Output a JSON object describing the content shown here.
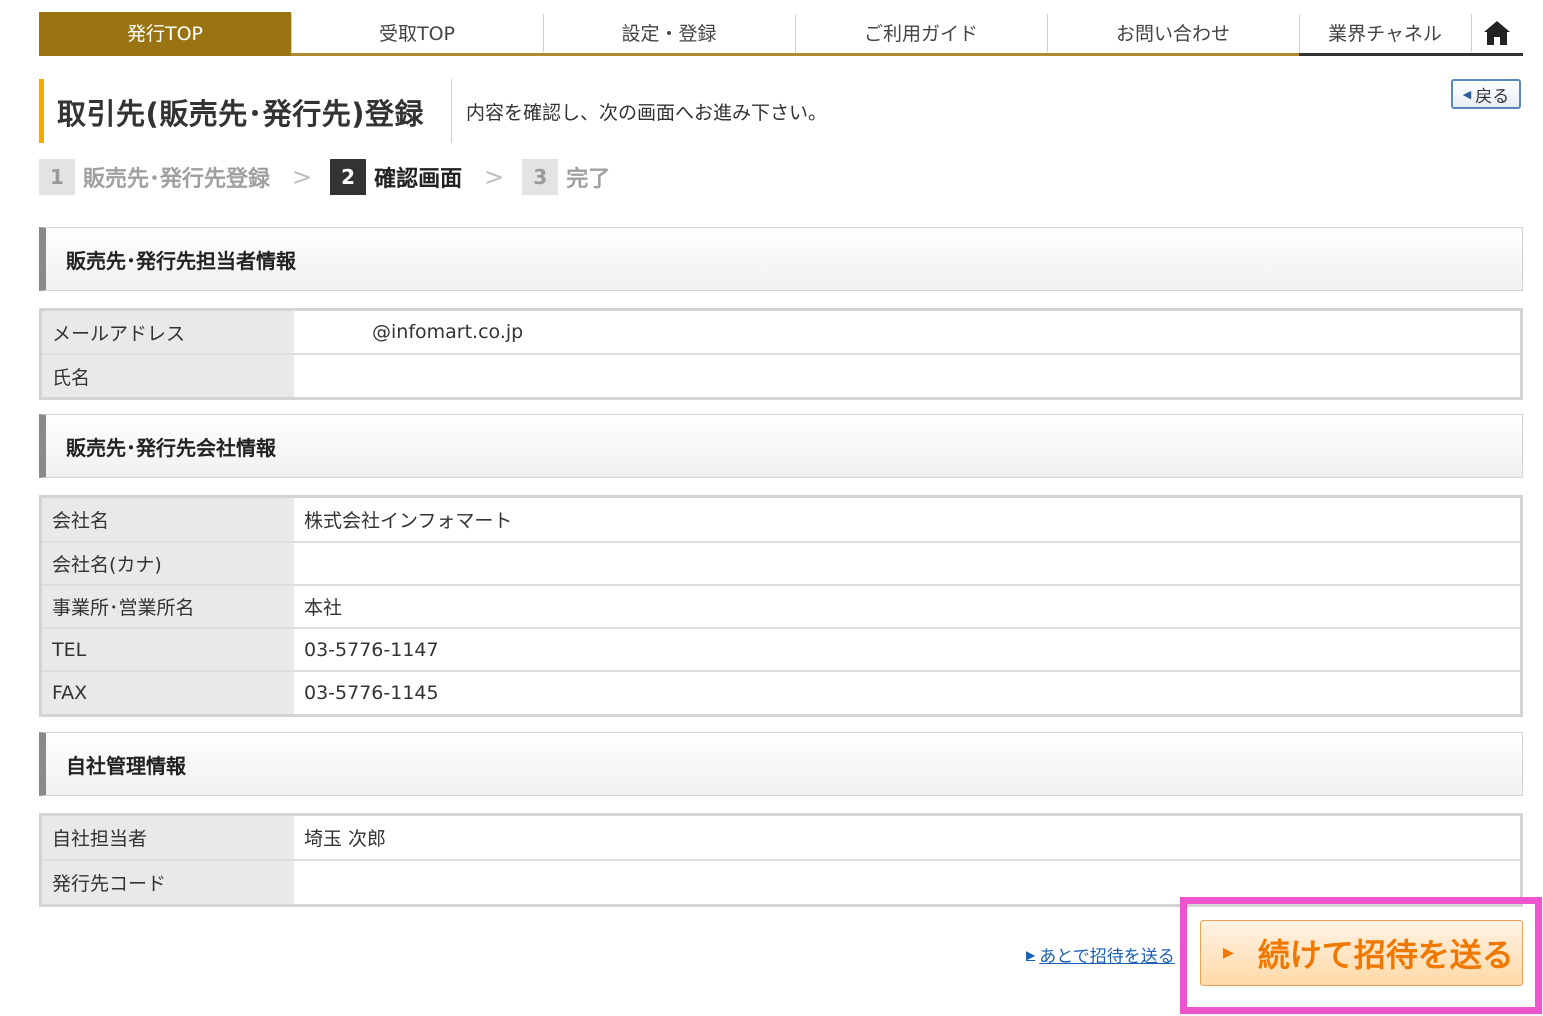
{
  "nav": {
    "tabs": [
      {
        "label": "発行TOP"
      },
      {
        "label": "受取TOP"
      },
      {
        "label": "設定・登録"
      },
      {
        "label": "ご利用ガイド"
      },
      {
        "label": "お問い合わせ"
      },
      {
        "label": "業界チャネル"
      }
    ],
    "home_icon": "home-icon"
  },
  "page": {
    "title": "取引先(販売先･発行先)登録",
    "instruction": "内容を確認し、次の画面へお進み下さい。",
    "back_label": "戻る"
  },
  "stepper": {
    "steps": [
      {
        "num": "1",
        "label": "販売先･発行先登録"
      },
      {
        "num": "2",
        "label": "確認画面"
      },
      {
        "num": "3",
        "label": "完了"
      }
    ],
    "current": 2
  },
  "sections": {
    "contact": {
      "title": "販売先･発行先担当者情報",
      "rows": [
        {
          "label": "メールアドレス",
          "value": "@infomart.co.jp"
        },
        {
          "label": "氏名",
          "value": ""
        }
      ]
    },
    "company": {
      "title": "販売先･発行先会社情報",
      "rows": [
        {
          "label": "会社名",
          "value": "株式会社インフォマート"
        },
        {
          "label": "会社名(カナ)",
          "value": ""
        },
        {
          "label": "事業所･営業所名",
          "value": "本社"
        },
        {
          "label": "TEL",
          "value": "03-5776-1147"
        },
        {
          "label": "FAX",
          "value": "03-5776-1145"
        }
      ]
    },
    "internal": {
      "title": "自社管理情報",
      "rows": [
        {
          "label": "自社担当者",
          "value": "埼玉 次郎"
        },
        {
          "label": "発行先コード",
          "value": ""
        }
      ]
    }
  },
  "actions": {
    "later_link": "あとで招待を送る",
    "continue_label": "続けて招待を送る"
  },
  "colors": {
    "nav_active": "#9a7312",
    "title_accent": "#f2a900",
    "continue_text": "#f07800",
    "highlight": "#ee55cc"
  }
}
